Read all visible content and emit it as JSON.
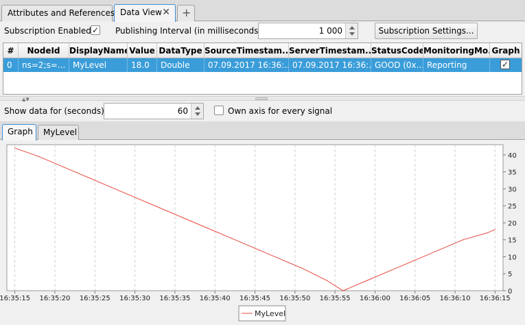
{
  "tabs": {
    "attributes_label": "Attributes and References",
    "dataview_label": "Data View",
    "close_glyph": "✕",
    "add_glyph": "+"
  },
  "subscription": {
    "enabled_label": "Subscription Enabled",
    "enabled_checked": true,
    "interval_label": "Publishing Interval (in milliseconds)",
    "interval_value": "1 000",
    "settings_button": "Subscription Settings..."
  },
  "table": {
    "columns": [
      "#",
      "NodeId",
      "DisplayName",
      "Value",
      "DataType",
      "SourceTimestam...",
      "ServerTimestam...",
      "StatusCode",
      "MonitoringMo...",
      "Graph"
    ],
    "rows": [
      {
        "index": "0",
        "node_id": "ns=2;s=...",
        "display_name": "MyLevel",
        "value": "18.0",
        "data_type": "Double",
        "source_ts": "07.09.2017 16:36:...",
        "server_ts": "07.09.2017 16:36:...",
        "status": "GOOD (0x...",
        "monitoring": "Reporting",
        "graph_checked": true
      }
    ]
  },
  "graph_controls": {
    "show_label": "Show data for (seconds)",
    "show_value": "60",
    "own_axis_label": "Own axis for every signal",
    "own_axis_checked": false
  },
  "subtabs": {
    "graph_label": "Graph",
    "mylevel_label": "MyLevel"
  },
  "colors": {
    "selection": "#3a9dd9",
    "series": "#e8453c",
    "grid": "#d0d0d0"
  },
  "chart_data": {
    "type": "line",
    "x_ticks": [
      "16:35:15",
      "16:35:20",
      "16:35:25",
      "16:35:30",
      "16:35:35",
      "16:35:40",
      "16:35:45",
      "16:35:50",
      "16:35:55",
      "16:36:00",
      "16:36:05",
      "16:36:10",
      "16:36:15"
    ],
    "y_ticks": [
      "0",
      "5",
      "10",
      "15",
      "20",
      "25",
      "30",
      "35",
      "40"
    ],
    "xlim": [
      "16:35:14",
      "16:36:16"
    ],
    "ylim": [
      0,
      43
    ],
    "grid": true,
    "legend": "bottom-center",
    "series": [
      {
        "name": "MyLevel",
        "x": [
          "16:35:15",
          "16:35:18",
          "16:35:21",
          "16:35:24",
          "16:35:27",
          "16:35:30",
          "16:35:33",
          "16:35:36",
          "16:35:39",
          "16:35:42",
          "16:35:45",
          "16:35:48",
          "16:35:51",
          "16:35:54",
          "16:35:56",
          "16:35:59",
          "16:36:02",
          "16:36:05",
          "16:36:08",
          "16:36:11",
          "16:36:14",
          "16:36:15"
        ],
        "y": [
          42,
          39.5,
          36.5,
          33.5,
          30.5,
          27.5,
          24.5,
          21.5,
          18.5,
          15.5,
          12.5,
          9.5,
          6.5,
          3.0,
          0,
          3.0,
          6.0,
          9.0,
          12.0,
          15.0,
          17.0,
          18.0
        ]
      }
    ]
  }
}
